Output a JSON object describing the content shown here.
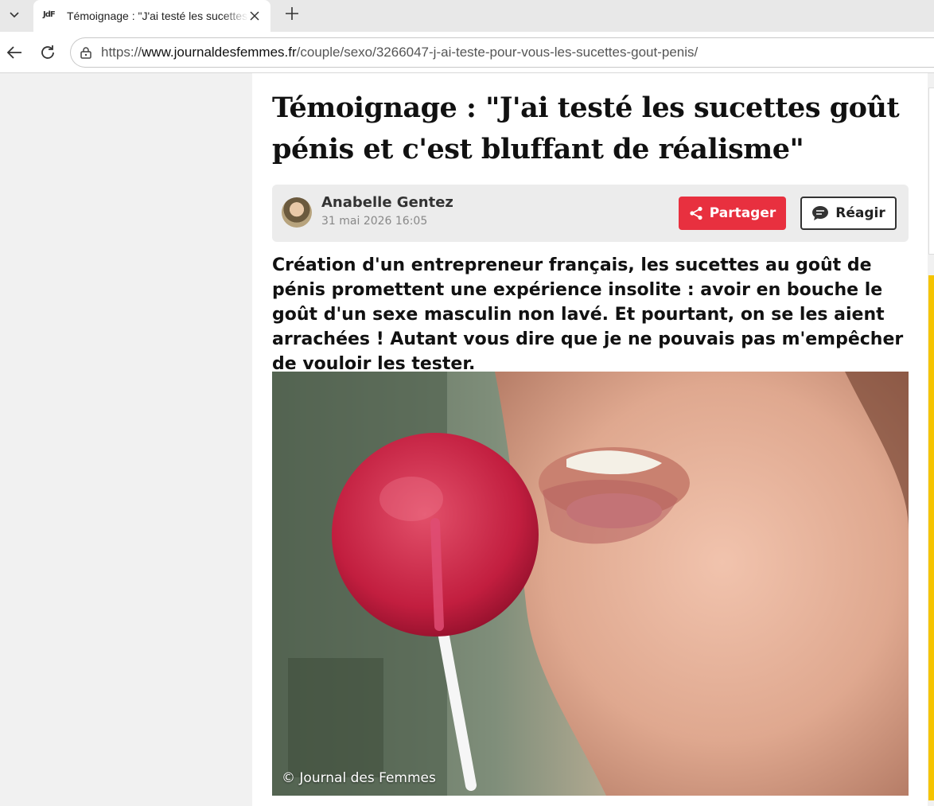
{
  "browser": {
    "tab_title": "Témoignage : \"J'ai testé les sucettes goût pénis et c'est bluffant de réalisme\"",
    "favicon_text": "JdF",
    "url_scheme": "https://",
    "url_host": "www.journaldesfemmes.fr",
    "url_path": "/couple/sexo/3266047-j-ai-teste-pour-vous-les-sucettes-gout-penis/"
  },
  "article": {
    "headline": "Témoignage : \"J'ai testé les sucettes goût pénis et c'est bluffant de réalisme\"",
    "author_name": "Anabelle Gentez",
    "date": "31 mai 2026 16:05",
    "share_label": "Partager",
    "react_label": "Réagir",
    "lead": "Création d'un entrepreneur français, les sucettes au goût de pénis promettent une expérience insolite : avoir en bouche le goût d'un sexe masculin non lavé. Et pourtant, on se les aient arrachées ! Autant vous dire que je ne pouvais pas m'empêcher de vouloir les tester.",
    "photo_credit": "© Journal des Femmes"
  },
  "colors": {
    "share_button": "#e8303f",
    "side_accent": "#f5c400",
    "page_background": "#f1f1f1"
  }
}
